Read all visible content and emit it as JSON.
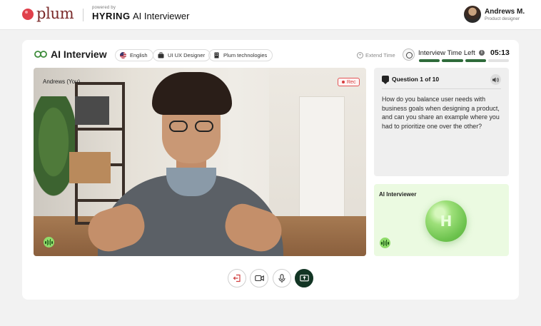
{
  "header": {
    "brand": "plum",
    "powered_by": "powered by",
    "hyring": "HYRING",
    "product": "AI Interviewer",
    "user": {
      "name": "Andrews M.",
      "role": "Product designer"
    }
  },
  "interview": {
    "title": "AI Interview",
    "chips": [
      {
        "label": "English",
        "icon": "us-flag-icon"
      },
      {
        "label": "UI UX Designer",
        "icon": "briefcase-icon"
      },
      {
        "label": "Plum technologies",
        "icon": "building-icon"
      }
    ],
    "extend_time": "Extend Time",
    "time_left_label": "Interview Time Left",
    "time_left_value": "05:13",
    "progress": {
      "segments_total": 4,
      "segments_filled": 3
    }
  },
  "video": {
    "participant_label": "Andrews (You)",
    "rec_label": "Rec"
  },
  "question": {
    "title": "Question 1 of 10",
    "text": "How do you balance user needs with business goals when designing a product, and can you share an example where you had to prioritize one over the other?"
  },
  "ai": {
    "label": "AI Interviewer",
    "orb_letter": "H"
  },
  "controls": [
    {
      "name": "leave-button",
      "icon": "exit-icon"
    },
    {
      "name": "camera-button",
      "icon": "video-camera-icon"
    },
    {
      "name": "mic-button",
      "icon": "microphone-icon"
    },
    {
      "name": "share-screen-button",
      "icon": "screen-share-icon"
    }
  ],
  "colors": {
    "brand_red": "#e0404b",
    "accent_green": "#2e6b3a",
    "ai_panel_bg": "#ebfae1",
    "rec_red": "#d63d3d"
  }
}
